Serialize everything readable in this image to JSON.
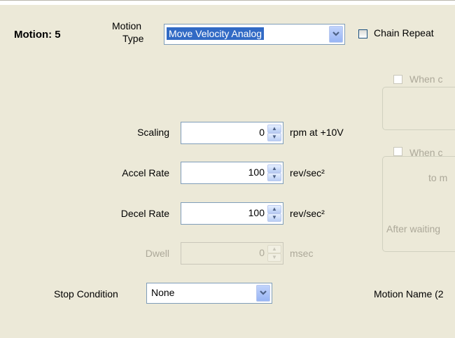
{
  "motion": {
    "label": "Motion: 5",
    "type_label_line1": "Motion",
    "type_label_line2": "Type",
    "type_value": "Move Velocity Analog",
    "chain_repeat_label": "Chain Repeat"
  },
  "groups": {
    "when1_label": "When c",
    "when2_label": "When c",
    "when2_sub": "to m",
    "after_waiting": "After waiting"
  },
  "fields": [
    {
      "label": "Scaling",
      "value": "0",
      "unit": "rpm at +10V",
      "enabled": true
    },
    {
      "label": "Accel Rate",
      "value": "100",
      "unit": "rev/sec²",
      "enabled": true
    },
    {
      "label": "Decel Rate",
      "value": "100",
      "unit": "rev/sec²",
      "enabled": true
    },
    {
      "label": "Dwell",
      "value": "0",
      "unit": "msec",
      "enabled": false
    }
  ],
  "stop_condition": {
    "label": "Stop Condition",
    "value": "None"
  },
  "motion_name_label": "Motion Name (2",
  "icons": {
    "spin_up": "up-arrow-icon",
    "spin_down": "down-arrow-icon",
    "combo": "chevron-down-icon"
  },
  "colors": {
    "panel_bg": "#ece9d8",
    "selection": "#316ac5",
    "field_border": "#7f9db9",
    "disabled_text": "#aca899"
  }
}
